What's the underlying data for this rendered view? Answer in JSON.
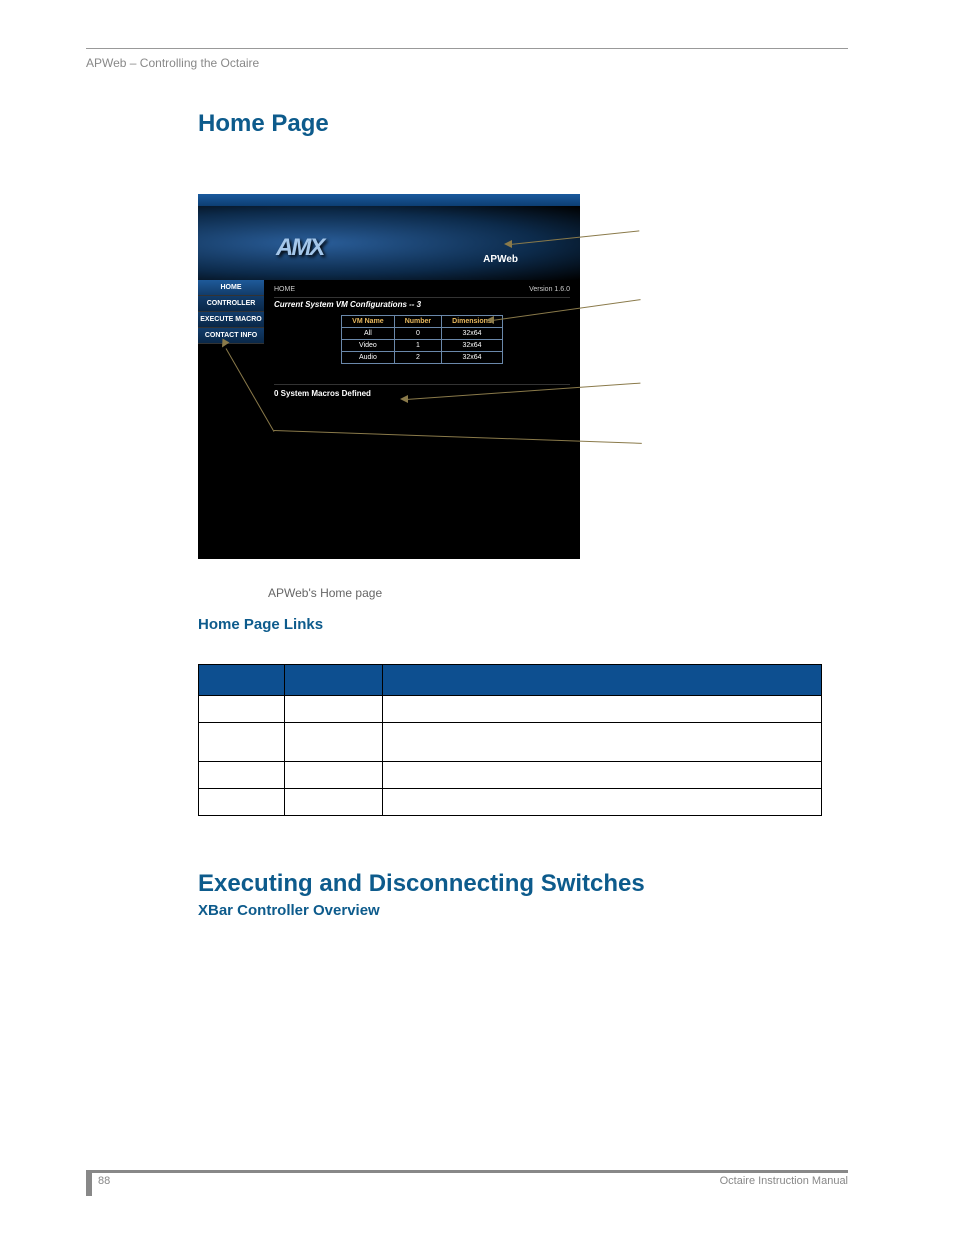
{
  "header": {
    "breadcrumb": "APWeb – Controlling the Octaire"
  },
  "section1": {
    "title": "Home Page",
    "caption": "APWeb's Home page",
    "links_heading": "Home Page Links"
  },
  "screenshot": {
    "brand_label": "APWeb",
    "logo": "AMX",
    "nav": {
      "home": "HOME",
      "controller": "CONTROLLER",
      "execute_macro": "EXECUTE MACRO",
      "contact_info": "CONTACT INFO"
    },
    "crumb": "HOME",
    "version": "Version 1.6.0",
    "vm_title": "Current System VM Configurations -- 3",
    "table": {
      "h1": "VM Name",
      "h2": "Number",
      "h3": "Dimensions",
      "rows": [
        {
          "a": "All",
          "b": "0",
          "c": "32x64"
        },
        {
          "a": "Video",
          "b": "1",
          "c": "32x64"
        },
        {
          "a": "Audio",
          "b": "2",
          "c": "32x64"
        }
      ]
    },
    "macros": "0 System Macros Defined"
  },
  "section2": {
    "title": "Executing and Disconnecting Switches",
    "subheading": "XBar Controller Overview"
  },
  "footer": {
    "page": "88",
    "manual": "Octaire Instruction Manual"
  }
}
